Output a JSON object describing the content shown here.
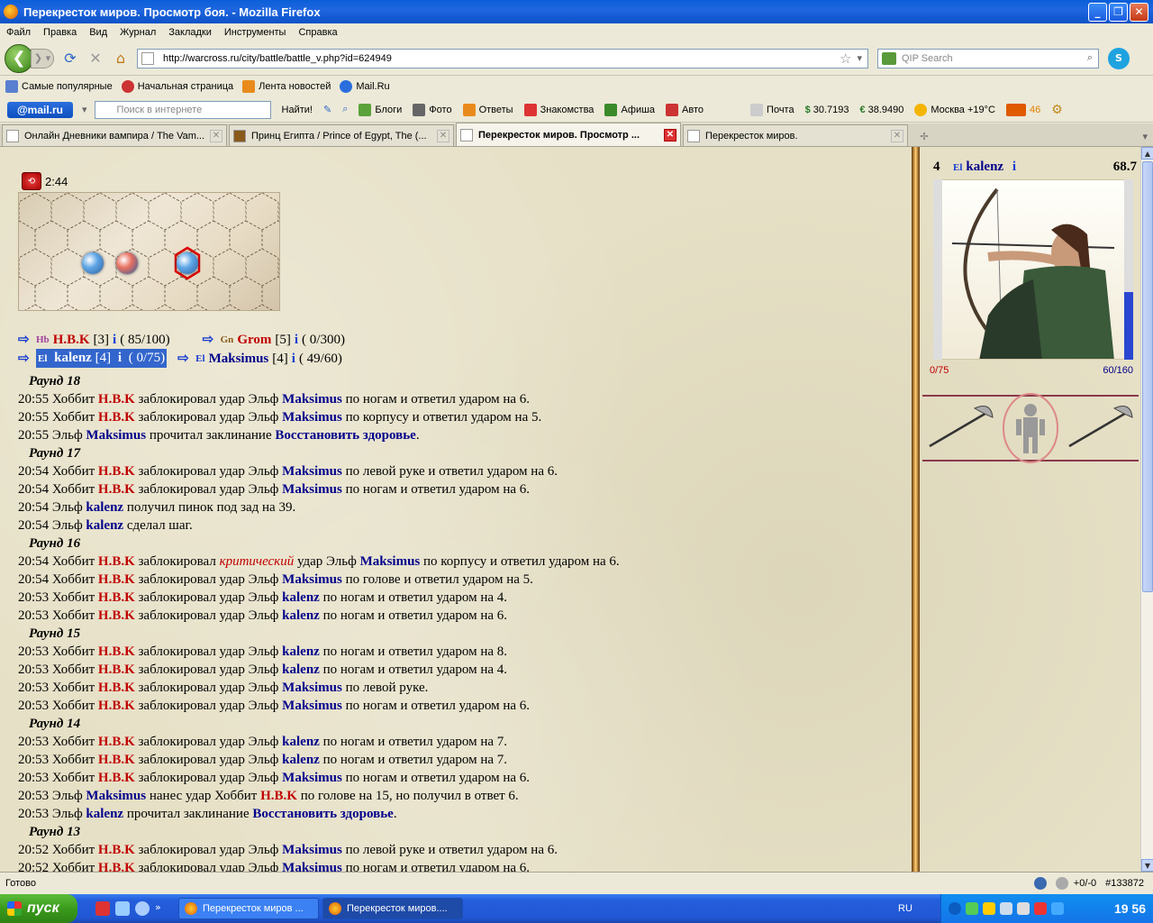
{
  "window": {
    "title": "Перекресток миров. Просмотр боя. - Mozilla Firefox"
  },
  "menu": [
    "Файл",
    "Правка",
    "Вид",
    "Журнал",
    "Закладки",
    "Инструменты",
    "Справка"
  ],
  "nav": {
    "url": "http://warcross.ru/city/battle/battle_v.php?id=624949",
    "search_placeholder": "QIP Search"
  },
  "bookmarks": [
    "Самые популярные",
    "Начальная страница",
    "Лента новостей",
    "Mail.Ru"
  ],
  "mailbar": {
    "logo": "@mail.ru",
    "search_placeholder": "Поиск в интернете",
    "find": "Найти!",
    "items": [
      "Блоги",
      "Фото",
      "Ответы",
      "Знакомства",
      "Афиша",
      "Авто"
    ],
    "mail": "Почта",
    "usd": "30.7193",
    "eur": "38.9490",
    "weather": "Москва +19°C",
    "cars": "46"
  },
  "tabs": [
    {
      "label": "Онлайн Дневники вампира / The Vam...",
      "active": false
    },
    {
      "label": "Принц Египта / Prince of Egypt, The (...",
      "active": false
    },
    {
      "label": "Перекресток миров. Просмотр ...",
      "active": true
    },
    {
      "label": "Перекресток миров.",
      "active": false
    }
  ],
  "battle": {
    "timer": "2:44",
    "teams": [
      [
        {
          "race": "Hb",
          "name": "H.B.K",
          "level": "[3]",
          "info": "i",
          "hp": "( 85/100)",
          "team": "red"
        },
        {
          "race": "Gn",
          "name": "Grom",
          "level": "[5]",
          "info": "i",
          "hp": "( 0/300)",
          "team": "red"
        }
      ],
      [
        {
          "race": "El",
          "name": "kalenz",
          "level": "[4]",
          "info": "i",
          "hp": "( 0/75)",
          "team": "blue",
          "selected": true
        },
        {
          "race": "El",
          "name": "Maksimus",
          "level": "[4]",
          "info": "i",
          "hp": "( 49/60)",
          "team": "blue"
        }
      ]
    ],
    "log": [
      {
        "round": "Раунд 18"
      },
      {
        "parts": [
          [
            "t",
            "20:55 Хоббит "
          ],
          [
            "r",
            "H.B.K"
          ],
          [
            "t",
            " заблокировал удар Эльф "
          ],
          [
            "b",
            "Maksimus"
          ],
          [
            "t",
            " по ногам и ответил ударом на 6."
          ]
        ]
      },
      {
        "parts": [
          [
            "t",
            "20:55 Хоббит "
          ],
          [
            "r",
            "H.B.K"
          ],
          [
            "t",
            " заблокировал удар Эльф "
          ],
          [
            "b",
            "Maksimus"
          ],
          [
            "t",
            " по корпусу и ответил ударом на 5."
          ]
        ]
      },
      {
        "parts": [
          [
            "t",
            "20:55 Эльф "
          ],
          [
            "b",
            "Maksimus"
          ],
          [
            "t",
            " прочитал заклинание "
          ],
          [
            "s",
            "Восстановить здоровье"
          ],
          [
            "t",
            "."
          ]
        ]
      },
      {
        "round": "Раунд 17"
      },
      {
        "parts": [
          [
            "t",
            "20:54 Хоббит "
          ],
          [
            "r",
            "H.B.K"
          ],
          [
            "t",
            " заблокировал удар Эльф "
          ],
          [
            "b",
            "Maksimus"
          ],
          [
            "t",
            " по левой руке и ответил ударом на 6."
          ]
        ]
      },
      {
        "parts": [
          [
            "t",
            "20:54 Хоббит "
          ],
          [
            "r",
            "H.B.K"
          ],
          [
            "t",
            " заблокировал удар Эльф "
          ],
          [
            "b",
            "Maksimus"
          ],
          [
            "t",
            " по ногам и ответил ударом на 6."
          ]
        ]
      },
      {
        "parts": [
          [
            "t",
            "20:54 Эльф "
          ],
          [
            "b",
            "kalenz"
          ],
          [
            "t",
            " получил пинок под зад на 39."
          ]
        ]
      },
      {
        "parts": [
          [
            "t",
            "20:54 Эльф "
          ],
          [
            "b",
            "kalenz"
          ],
          [
            "t",
            " сделал шаг."
          ]
        ]
      },
      {
        "round": "Раунд 16"
      },
      {
        "parts": [
          [
            "t",
            "20:54 Хоббит "
          ],
          [
            "r",
            "H.B.K"
          ],
          [
            "t",
            " заблокировал "
          ],
          [
            "c",
            "критический"
          ],
          [
            "t",
            " удар Эльф "
          ],
          [
            "b",
            "Maksimus"
          ],
          [
            "t",
            " по корпусу и ответил ударом на 6."
          ]
        ]
      },
      {
        "parts": [
          [
            "t",
            "20:54 Хоббит "
          ],
          [
            "r",
            "H.B.K"
          ],
          [
            "t",
            " заблокировал удар Эльф "
          ],
          [
            "b",
            "Maksimus"
          ],
          [
            "t",
            " по голове и ответил ударом на 5."
          ]
        ]
      },
      {
        "parts": [
          [
            "t",
            "20:53 Хоббит "
          ],
          [
            "r",
            "H.B.K"
          ],
          [
            "t",
            " заблокировал удар Эльф "
          ],
          [
            "b",
            "kalenz"
          ],
          [
            "t",
            " по ногам и ответил ударом на 4."
          ]
        ]
      },
      {
        "parts": [
          [
            "t",
            "20:53 Хоббит "
          ],
          [
            "r",
            "H.B.K"
          ],
          [
            "t",
            " заблокировал удар Эльф "
          ],
          [
            "b",
            "kalenz"
          ],
          [
            "t",
            " по ногам и ответил ударом на 6."
          ]
        ]
      },
      {
        "round": "Раунд 15"
      },
      {
        "parts": [
          [
            "t",
            "20:53 Хоббит "
          ],
          [
            "r",
            "H.B.K"
          ],
          [
            "t",
            " заблокировал удар Эльф "
          ],
          [
            "b",
            "kalenz"
          ],
          [
            "t",
            " по ногам и ответил ударом на 8."
          ]
        ]
      },
      {
        "parts": [
          [
            "t",
            "20:53 Хоббит "
          ],
          [
            "r",
            "H.B.K"
          ],
          [
            "t",
            " заблокировал удар Эльф "
          ],
          [
            "b",
            "kalenz"
          ],
          [
            "t",
            " по ногам и ответил ударом на 4."
          ]
        ]
      },
      {
        "parts": [
          [
            "t",
            "20:53 Хоббит "
          ],
          [
            "r",
            "H.B.K"
          ],
          [
            "t",
            " заблокировал удар Эльф "
          ],
          [
            "b",
            "Maksimus"
          ],
          [
            "t",
            " по левой руке."
          ]
        ]
      },
      {
        "parts": [
          [
            "t",
            "20:53 Хоббит "
          ],
          [
            "r",
            "H.B.K"
          ],
          [
            "t",
            " заблокировал удар Эльф "
          ],
          [
            "b",
            "Maksimus"
          ],
          [
            "t",
            " по ногам и ответил ударом на 6."
          ]
        ]
      },
      {
        "round": "Раунд 14"
      },
      {
        "parts": [
          [
            "t",
            "20:53 Хоббит "
          ],
          [
            "r",
            "H.B.K"
          ],
          [
            "t",
            " заблокировал удар Эльф "
          ],
          [
            "b",
            "kalenz"
          ],
          [
            "t",
            " по ногам и ответил ударом на 7."
          ]
        ]
      },
      {
        "parts": [
          [
            "t",
            "20:53 Хоббит "
          ],
          [
            "r",
            "H.B.K"
          ],
          [
            "t",
            " заблокировал удар Эльф "
          ],
          [
            "b",
            "kalenz"
          ],
          [
            "t",
            " по ногам и ответил ударом на 7."
          ]
        ]
      },
      {
        "parts": [
          [
            "t",
            "20:53 Хоббит "
          ],
          [
            "r",
            "H.B.K"
          ],
          [
            "t",
            " заблокировал удар Эльф "
          ],
          [
            "b",
            "Maksimus"
          ],
          [
            "t",
            " по ногам и ответил ударом на 6."
          ]
        ]
      },
      {
        "parts": [
          [
            "t",
            "20:53 Эльф "
          ],
          [
            "b",
            "Maksimus"
          ],
          [
            "t",
            " нанес удар Хоббит "
          ],
          [
            "r",
            "H.B.K"
          ],
          [
            "t",
            " по голове на 15, но получил в ответ 6."
          ]
        ]
      },
      {
        "parts": [
          [
            "t",
            "20:53 Эльф "
          ],
          [
            "b",
            "kalenz"
          ],
          [
            "t",
            " прочитал заклинание "
          ],
          [
            "s",
            "Восстановить здоровье"
          ],
          [
            "t",
            "."
          ]
        ]
      },
      {
        "round": "Раунд 13"
      },
      {
        "parts": [
          [
            "t",
            "20:52 Хоббит "
          ],
          [
            "r",
            "H.B.K"
          ],
          [
            "t",
            " заблокировал удар Эльф "
          ],
          [
            "b",
            "Maksimus"
          ],
          [
            "t",
            " по левой руке и ответил ударом на 6."
          ]
        ]
      },
      {
        "parts": [
          [
            "t",
            "20:52 Хоббит "
          ],
          [
            "r",
            "H.B.K"
          ],
          [
            "t",
            " заблокировал удар Эльф "
          ],
          [
            "b",
            "Maksimus"
          ],
          [
            "t",
            " по ногам и ответил ударом на 6."
          ]
        ]
      }
    ]
  },
  "panel": {
    "level": "4",
    "race": "El",
    "name": "kalenz",
    "info": "i",
    "weight": "68.7",
    "hp": "0/75",
    "mp": "60/160",
    "mp_fraction": 0.375
  },
  "statusbar": {
    "text": "Готово",
    "right": "+0/-0",
    "id": "#133872"
  },
  "taskbar": {
    "start": "пуск",
    "tasks": [
      "Перекресток миров ...",
      "Перекресток миров...."
    ],
    "lang": "RU",
    "clock": "19 56"
  }
}
